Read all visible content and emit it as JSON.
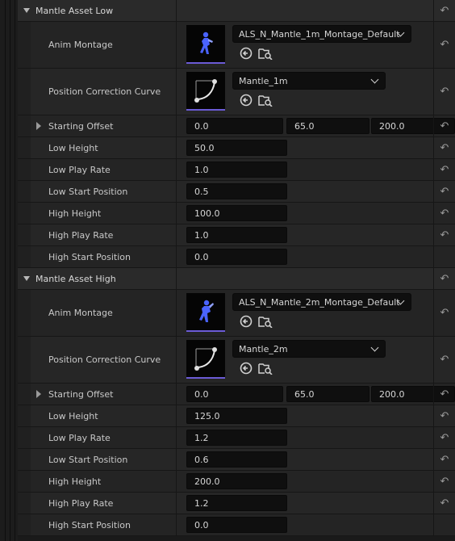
{
  "reset_glyph": "↶",
  "sections": [
    {
      "title": "Mantle Asset Low",
      "anim_montage": {
        "label": "Anim Montage",
        "value": "ALS_N_Mantle_1m_Montage_Default",
        "thumbnail_icon": "animation-montage-thumbnail-icon"
      },
      "position_correction_curve": {
        "label": "Position Correction Curve",
        "value": "Mantle_1m",
        "thumbnail_icon": "curve-asset-thumbnail-icon"
      },
      "starting_offset": {
        "label": "Starting Offset",
        "x": "0.0",
        "y": "65.0",
        "z": "200.0"
      },
      "low_height": {
        "label": "Low Height",
        "value": "50.0"
      },
      "low_play_rate": {
        "label": "Low Play Rate",
        "value": "1.0"
      },
      "low_start_position": {
        "label": "Low Start Position",
        "value": "0.5"
      },
      "high_height": {
        "label": "High Height",
        "value": "100.0"
      },
      "high_play_rate": {
        "label": "High Play Rate",
        "value": "1.0"
      },
      "high_start_position": {
        "label": "High Start Position",
        "value": "0.0"
      }
    },
    {
      "title": "Mantle Asset High",
      "anim_montage": {
        "label": "Anim Montage",
        "value": "ALS_N_Mantle_2m_Montage_Default",
        "thumbnail_icon": "animation-montage-thumbnail-icon"
      },
      "position_correction_curve": {
        "label": "Position Correction Curve",
        "value": "Mantle_2m",
        "thumbnail_icon": "curve-asset-thumbnail-icon"
      },
      "starting_offset": {
        "label": "Starting Offset",
        "x": "0.0",
        "y": "65.0",
        "z": "200.0"
      },
      "low_height": {
        "label": "Low Height",
        "value": "125.0"
      },
      "low_play_rate": {
        "label": "Low Play Rate",
        "value": "1.2"
      },
      "low_start_position": {
        "label": "Low Start Position",
        "value": "0.6"
      },
      "high_height": {
        "label": "High Height",
        "value": "200.0"
      },
      "high_play_rate": {
        "label": "High Play Rate",
        "value": "1.2"
      },
      "high_start_position": {
        "label": "High Start Position",
        "value": "0.0"
      }
    }
  ],
  "colors": {
    "thumbnail_underline": "#6b5bd6",
    "montage_figure": "#4a63ff",
    "curve_stroke": "#e8e8e8"
  }
}
